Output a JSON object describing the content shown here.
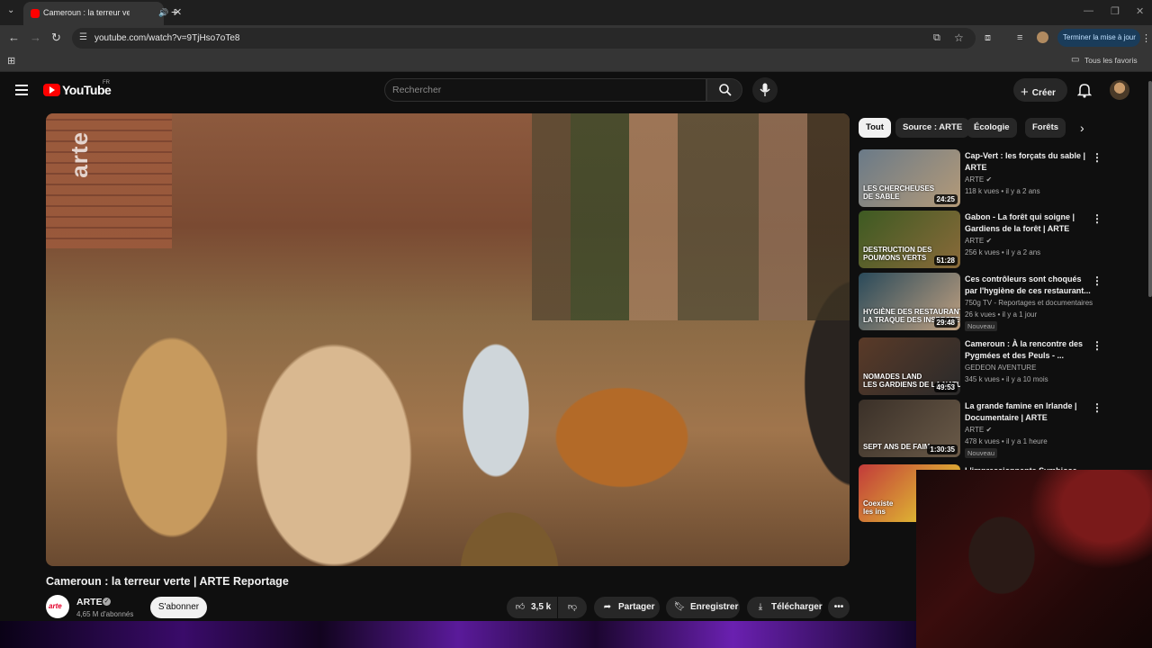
{
  "browser": {
    "tab_title": "Cameroun : la terreur verte",
    "tab_audio": "🔊",
    "tab_close": "✕",
    "new_tab": "+",
    "url": "youtube.com/watch?v=9TjHso7oTe8",
    "update_button": "Terminer la mise à jour",
    "bookmarks_all": "Tous les favoris"
  },
  "youtube": {
    "logo": "YouTube",
    "country_code": "FR",
    "search_placeholder": "Rechercher",
    "create_label": "Créer"
  },
  "video": {
    "brand_watermark": "arte",
    "title": "Cameroun : la terreur verte | ARTE Reportage",
    "channel": "ARTE",
    "channel_avatar_text": "arte",
    "subscribers": "4,65 M d'abonnés",
    "subscribe_label": "S'abonner",
    "likes": "3,5 k",
    "share_label": "Partager",
    "save_label": "Enregistrer",
    "download_label": "Télécharger"
  },
  "chips": [
    "Tout",
    "Source : ARTE",
    "Écologie",
    "Forêts"
  ],
  "recommendations": [
    {
      "title": "Cap-Vert : les forçats du sable | ARTE",
      "channel": "ARTE",
      "verified": true,
      "meta": "118 k vues • il y a 2 ans",
      "duration": "24:25",
      "overlay": "LES CHERCHEUSES\nDE SABLE",
      "badge": "",
      "colors": [
        "#6a7a88",
        "#b49a78"
      ]
    },
    {
      "title": "Gabon - La forêt qui soigne | Gardiens de la forêt | ARTE",
      "channel": "ARTE",
      "verified": true,
      "meta": "256 k vues • il y a 2 ans",
      "duration": "51:28",
      "overlay": "DESTRUCTION DES\nPOUMONS VERTS",
      "badge": "",
      "colors": [
        "#3d5a22",
        "#8a6a3a"
      ]
    },
    {
      "title": "Ces contrôleurs sont choqués par l'hygiène de ces restaurant...",
      "channel": "750g TV - Reportages et documentaires",
      "verified": false,
      "meta": "26 k vues • il y a 1 jour",
      "duration": "29:48",
      "overlay": "HYGIÈNE DES RESTAURANTS\nLA TRAQUE DES INSPECTEURS",
      "badge": "Nouveau",
      "colors": [
        "#2a4a5a",
        "#c0a080"
      ]
    },
    {
      "title": "Cameroun : À la rencontre des Pygmées et des Peuls - ...",
      "channel": "GEDEON AVENTURE",
      "verified": false,
      "meta": "345 k vues • il y a 10 mois",
      "duration": "49:53",
      "overlay": "NOMADES LAND\nLES GARDIENS DE LA NATURE",
      "badge": "",
      "colors": [
        "#5a3a28",
        "#2a2a2a"
      ]
    },
    {
      "title": "La grande famine en Irlande | Documentaire | ARTE",
      "channel": "ARTE",
      "verified": true,
      "meta": "478 k vues • il y a 1 heure",
      "duration": "1:30:35",
      "overlay": "SEPT ANS DE FAIM",
      "badge": "Nouveau",
      "colors": [
        "#3a3028",
        "#6a5a48"
      ]
    },
    {
      "title": "L'impressionnante Symbiose du...",
      "channel": "",
      "verified": false,
      "meta": "",
      "duration": "",
      "overlay": "Coexiste\nles ins",
      "badge": "",
      "colors": [
        "#c23a3a",
        "#e8e030"
      ]
    }
  ]
}
